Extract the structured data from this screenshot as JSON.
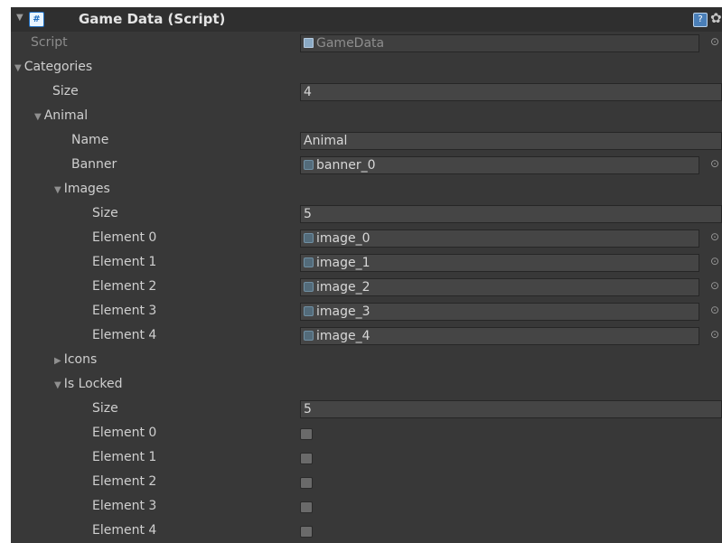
{
  "component": {
    "title": "Game Data (Script)",
    "script_label": "Script",
    "script_value": "GameData"
  },
  "categories": {
    "label": "Categories",
    "size_label": "Size",
    "size_value": "4",
    "animal": {
      "label": "Animal",
      "name_label": "Name",
      "name_value": "Animal",
      "banner_label": "Banner",
      "banner_value": "banner_0",
      "images": {
        "label": "Images",
        "size_label": "Size",
        "size_value": "5",
        "elements": [
          {
            "label": "Element 0",
            "value": "image_0"
          },
          {
            "label": "Element 1",
            "value": "image_1"
          },
          {
            "label": "Element 2",
            "value": "image_2"
          },
          {
            "label": "Element 3",
            "value": "image_3"
          },
          {
            "label": "Element 4",
            "value": "image_4"
          }
        ]
      },
      "icons": {
        "label": "Icons"
      },
      "is_locked": {
        "label": "Is Locked",
        "size_label": "Size",
        "size_value": "5",
        "elements": [
          {
            "label": "Element 0",
            "checked": false
          },
          {
            "label": "Element 1",
            "checked": false
          },
          {
            "label": "Element 2",
            "checked": false
          },
          {
            "label": "Element 3",
            "checked": false
          },
          {
            "label": "Element 4",
            "checked": false
          }
        ]
      }
    }
  },
  "icons": {
    "fold_open": "▼",
    "fold_closed": "▶",
    "object_picker": "⊙",
    "help": "?",
    "gear": "✿"
  }
}
